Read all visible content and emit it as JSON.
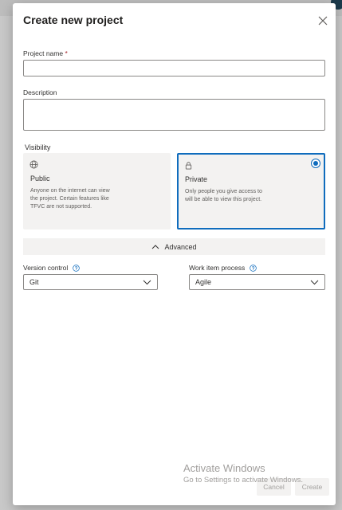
{
  "dialog": {
    "title": "Create new project"
  },
  "project_name": {
    "label": "Project name",
    "required_mark": "*",
    "value": "",
    "placeholder": ""
  },
  "description": {
    "label": "Description",
    "value": "",
    "placeholder": ""
  },
  "visibility": {
    "label": "Visibility",
    "options": [
      {
        "title": "Public",
        "icon": "globe-icon",
        "description": "Anyone on the internet can view the project. Certain features like TFVC are not supported.",
        "selected": false
      },
      {
        "title": "Private",
        "icon": "lock-icon",
        "description": "Only people you give access to will be able to view this project.",
        "selected": true
      }
    ]
  },
  "advanced": {
    "label": "Advanced",
    "expanded": true
  },
  "version_control": {
    "label": "Version control",
    "value": "Git"
  },
  "work_item_process": {
    "label": "Work item process",
    "value": "Agile"
  },
  "watermark": {
    "line1": "Activate Windows",
    "line2": "Go to Settings to activate Windows."
  },
  "buttons": {
    "cancel": "Cancel",
    "create": "Create"
  },
  "colors": {
    "accent": "#0f6cbd",
    "required": "#a4262c",
    "card_bg": "#f3f2f1"
  }
}
